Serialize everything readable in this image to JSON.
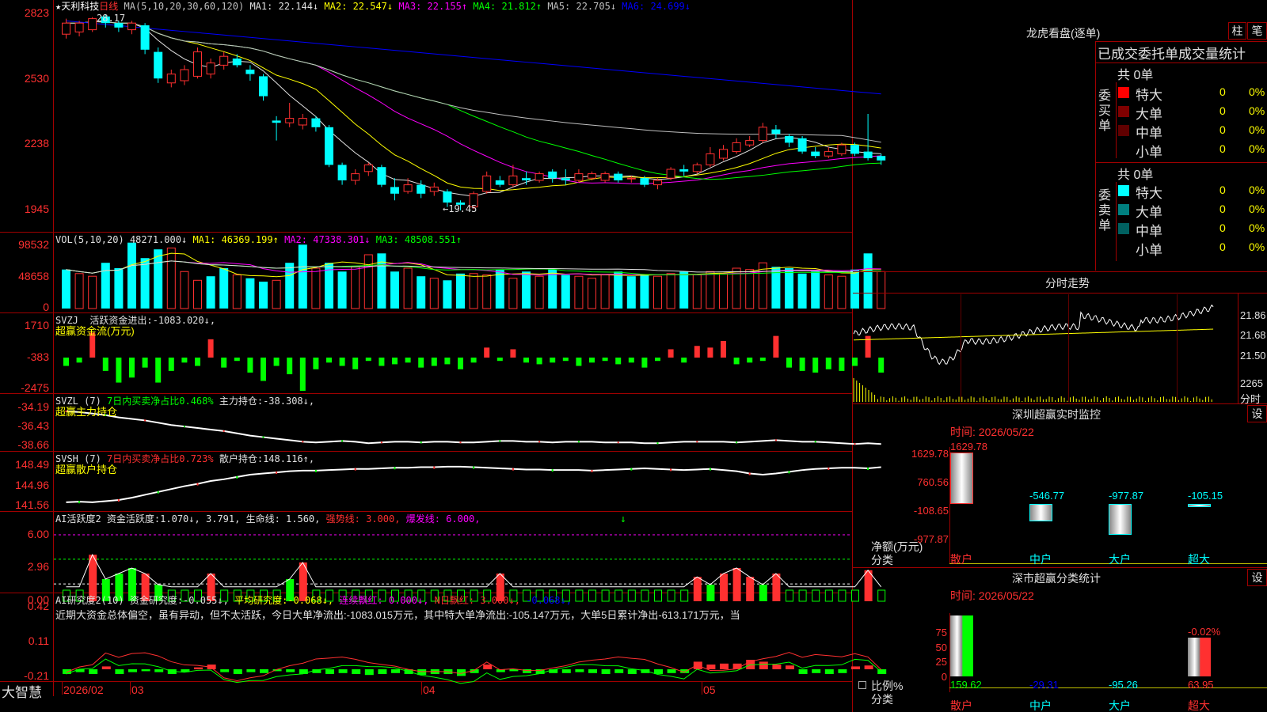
{
  "main": {
    "title_star": "★",
    "stock_name": "天利科技",
    "period": "日线",
    "ma_label": "MA(5,10,20,30,60,120)",
    "ma": [
      {
        "label": "MA1:",
        "value": "22.144",
        "arrow": "↓",
        "color": "#e0e0e0"
      },
      {
        "label": "MA2:",
        "value": "22.547",
        "arrow": "↓",
        "color": "#ffff00"
      },
      {
        "label": "MA3:",
        "value": "22.155",
        "arrow": "↑",
        "color": "#ff00ff"
      },
      {
        "label": "MA4:",
        "value": "21.812",
        "arrow": "↑",
        "color": "#00ff00"
      },
      {
        "label": "MA5:",
        "value": "22.705",
        "arrow": "↓",
        "color": "#c0c0c0"
      },
      {
        "label": "MA6:",
        "value": "24.699",
        "arrow": "↓",
        "color": "#0000ff"
      }
    ],
    "high_label": "28.17",
    "low_label": "←19.45",
    "y_labels": [
      "2823",
      "2530",
      "2238",
      "1945"
    ]
  },
  "vol": {
    "label": "VOL(5,10,20)",
    "value": "48271.000",
    "arrow": "↓",
    "ma": [
      {
        "label": "MA1:",
        "value": "46369.199",
        "arrow": "↑",
        "color": "#ffff00"
      },
      {
        "label": "MA2:",
        "value": "47338.301",
        "arrow": "↓",
        "color": "#ff00ff"
      },
      {
        "label": "MA3:",
        "value": "48508.551",
        "arrow": "↑",
        "color": "#00ff00"
      }
    ],
    "y_labels": [
      "98532",
      "48658",
      "0"
    ]
  },
  "svzj": {
    "label": "SVZJ",
    "title": "活跃资金进出:",
    "value": "-1083.020",
    "arrow": "↓,",
    "subtitle": "超赢资金流(万元)",
    "y_labels": [
      "1710",
      "-383",
      "-2475"
    ]
  },
  "svzl": {
    "label": "SVZL (7)",
    "desc": "7日内买卖净占比0.468%",
    "title": "主力持仓:",
    "value": "-38.308",
    "arrow": "↓,",
    "subtitle": "超赢主力持仓",
    "y_labels": [
      "-34.19",
      "-36.43",
      "-38.66"
    ]
  },
  "svsh": {
    "label": "SVSH (7)",
    "desc": "7日内买卖净占比0.723%",
    "title": "散户持仓:",
    "value": "148.116",
    "arrow": "↑,",
    "subtitle": "超赢散户持仓",
    "y_labels": [
      "148.49",
      "144.96",
      "141.56"
    ]
  },
  "ai_active": {
    "label": "AI活跃度2",
    "t1": "资金活跃度:",
    "v1": "1.070",
    "a1": "↓,",
    "v2": "3.791",
    "a2": ",",
    "t3": "生命线:",
    "v3": "1.560",
    "a3": ",",
    "t4": "强势线:",
    "v4": "3.000",
    "a4": ",",
    "t5": "爆发线:",
    "v5": "6.000",
    "a5": ",",
    "y_labels": [
      "6.00",
      "2.96",
      "0.00"
    ]
  },
  "ai_research": {
    "label": "AI研究度2(10)",
    "t1": "资金研究度:",
    "v1": "-0.055",
    "a1": "↓,",
    "t2": "平均研究度:",
    "v2": "-0.068",
    "a2": "↓,",
    "t3": "连续飘红:",
    "v3": "0.000",
    "a3": "↓,",
    "t4": "N日飘红:",
    "v4": "3.000",
    "a4": "↓,",
    "v5": "-0.068",
    "a5": "↓,",
    "comment": "近期大资金总体偏空，虽有异动，但不太活跃，今日大单净流出:-1083.015万元，其中特大单净流出:-105.147万元，大单5日累计净出-613.171万元，当",
    "y_labels": [
      "0.42",
      "0.11",
      "-0.21"
    ]
  },
  "footer": {
    "brand": "大智慧",
    "months": [
      "2026/02",
      "03",
      "04",
      "05"
    ]
  },
  "right": {
    "panel_title": "龙虎看盘(逐单)",
    "tab1": "柱",
    "tab2": "笔",
    "stats_title": "已成交委托单成交量统计",
    "buy": {
      "side_label": "委买单",
      "total": "共 0单",
      "rows": [
        {
          "name": "特大",
          "v": "0",
          "p": "0%",
          "color": "#ff0000"
        },
        {
          "name": "大单",
          "v": "0",
          "p": "0%",
          "color": "#800000"
        },
        {
          "name": "中单",
          "v": "0",
          "p": "0%",
          "color": "#600000"
        },
        {
          "name": "小单",
          "v": "0",
          "p": "0%",
          "color": "#000000"
        }
      ]
    },
    "sell": {
      "side_label": "委卖单",
      "total": "共 0单",
      "rows": [
        {
          "name": "特大",
          "v": "0",
          "p": "0%",
          "color": "#00ffff"
        },
        {
          "name": "大单",
          "v": "0",
          "p": "0%",
          "color": "#008080"
        },
        {
          "name": "中单",
          "v": "0",
          "p": "0%",
          "color": "#006060"
        },
        {
          "name": "小单",
          "v": "0",
          "p": "0%",
          "color": "#000000"
        }
      ]
    },
    "intraday": {
      "title": "分时走势",
      "y_labels": [
        "21.86",
        "21.68",
        "21.50"
      ],
      "vol_label": "2265",
      "vol_unit": "分时"
    },
    "monitor": {
      "title": "深圳超赢实时监控",
      "set": "设",
      "time": "时间: 2026/05/22",
      "y_labels": [
        "1629.78",
        "760.56",
        "-108.65",
        "-977.87"
      ],
      "unit1": "净额(万元)",
      "unit2": "分类",
      "bars": [
        {
          "cat": "散户",
          "value": "1629.78",
          "v": 1629.78
        },
        {
          "cat": "中户",
          "value": "-546.77",
          "v": -546.77
        },
        {
          "cat": "大户",
          "value": "-977.87",
          "v": -977.87
        },
        {
          "cat": "超大",
          "value": "-105.15",
          "v": -105.15
        }
      ]
    },
    "category": {
      "title": "深市超赢分类统计",
      "set": "设",
      "time": "时间: 2026/05/22",
      "y_labels": [
        "75",
        "50",
        "25",
        "0"
      ],
      "unit1": "比例%",
      "unit2": "分类",
      "top_label": "-0.02%",
      "cats": [
        {
          "cat": "散户",
          "value": "159.62",
          "color": "#00ff00",
          "h": 100
        },
        {
          "cat": "中户",
          "value": "-29.31",
          "color": "#0000ff",
          "h": 0
        },
        {
          "cat": "大户",
          "value": "-95.26",
          "color": "#00ffff",
          "h": 0
        },
        {
          "cat": "超大",
          "value": "63.95",
          "color": "#ff3030",
          "h": 64
        }
      ]
    }
  },
  "chart_data": {
    "type": "candlestick",
    "title": "天利科技 日线",
    "candles": [
      {
        "o": 27.4,
        "c": 27.9,
        "h": 28.1,
        "l": 27.2
      },
      {
        "o": 27.5,
        "c": 27.9,
        "h": 28.0,
        "l": 27.3
      },
      {
        "o": 27.6,
        "c": 28.1,
        "h": 28.17,
        "l": 27.5
      },
      {
        "o": 28.2,
        "c": 27.9,
        "h": 28.3,
        "l": 27.7
      },
      {
        "o": 27.9,
        "c": 27.7,
        "h": 28.0,
        "l": 27.5
      },
      {
        "o": 27.6,
        "c": 27.9,
        "h": 28.0,
        "l": 27.4
      },
      {
        "o": 27.8,
        "c": 26.7,
        "h": 27.9,
        "l": 26.5
      },
      {
        "o": 26.6,
        "c": 25.4,
        "h": 26.8,
        "l": 25.2
      },
      {
        "o": 25.2,
        "c": 25.6,
        "h": 25.8,
        "l": 25.0
      },
      {
        "o": 25.3,
        "c": 25.8,
        "h": 26.0,
        "l": 25.1
      },
      {
        "o": 25.5,
        "c": 26.6,
        "h": 26.8,
        "l": 25.4
      },
      {
        "o": 25.6,
        "c": 26.1,
        "h": 26.3,
        "l": 25.4
      },
      {
        "o": 26.0,
        "c": 26.4,
        "h": 26.6,
        "l": 25.8
      },
      {
        "o": 26.3,
        "c": 26.0,
        "h": 26.5,
        "l": 25.9
      },
      {
        "o": 25.8,
        "c": 25.6,
        "h": 26.0,
        "l": 25.3
      },
      {
        "o": 25.5,
        "c": 24.6,
        "h": 25.6,
        "l": 24.4
      },
      {
        "o": 23.5,
        "c": 23.4,
        "h": 23.7,
        "l": 22.6
      },
      {
        "o": 23.4,
        "c": 23.6,
        "h": 24.3,
        "l": 23.2
      },
      {
        "o": 23.3,
        "c": 23.6,
        "h": 23.8,
        "l": 23.1
      },
      {
        "o": 23.6,
        "c": 23.2,
        "h": 23.7,
        "l": 23.0
      },
      {
        "o": 23.2,
        "c": 21.5,
        "h": 23.3,
        "l": 21.4
      },
      {
        "o": 21.5,
        "c": 20.8,
        "h": 21.6,
        "l": 20.6
      },
      {
        "o": 20.8,
        "c": 21.1,
        "h": 21.3,
        "l": 20.6
      },
      {
        "o": 21.2,
        "c": 21.5,
        "h": 21.6,
        "l": 21.0
      },
      {
        "o": 21.4,
        "c": 20.6,
        "h": 21.5,
        "l": 20.5
      },
      {
        "o": 20.5,
        "c": 20.2,
        "h": 20.9,
        "l": 19.9
      },
      {
        "o": 20.3,
        "c": 20.6,
        "h": 20.9,
        "l": 20.2
      },
      {
        "o": 20.6,
        "c": 20.2,
        "h": 20.8,
        "l": 20.0
      },
      {
        "o": 20.3,
        "c": 20.5,
        "h": 20.7,
        "l": 20.1
      },
      {
        "o": 20.3,
        "c": 19.8,
        "h": 20.4,
        "l": 19.6
      },
      {
        "o": 19.8,
        "c": 19.7,
        "h": 19.9,
        "l": 19.45
      },
      {
        "o": 19.6,
        "c": 20.2,
        "h": 20.3,
        "l": 19.5
      },
      {
        "o": 20.3,
        "c": 21.0,
        "h": 21.2,
        "l": 20.2
      },
      {
        "o": 20.8,
        "c": 20.6,
        "h": 21.0,
        "l": 20.5
      },
      {
        "o": 20.6,
        "c": 21.0,
        "h": 21.5,
        "l": 20.5
      },
      {
        "o": 20.9,
        "c": 20.8,
        "h": 21.2,
        "l": 20.6
      },
      {
        "o": 20.8,
        "c": 21.1,
        "h": 21.2,
        "l": 20.7
      },
      {
        "o": 21.2,
        "c": 20.9,
        "h": 21.3,
        "l": 20.7
      },
      {
        "o": 20.9,
        "c": 20.8,
        "h": 21.3,
        "l": 20.6
      },
      {
        "o": 20.8,
        "c": 21.1,
        "h": 21.3,
        "l": 20.7
      },
      {
        "o": 20.9,
        "c": 21.1,
        "h": 21.2,
        "l": 20.8
      },
      {
        "o": 20.8,
        "c": 21.1,
        "h": 21.2,
        "l": 20.7
      },
      {
        "o": 21.1,
        "c": 20.8,
        "h": 21.2,
        "l": 20.7
      },
      {
        "o": 20.9,
        "c": 20.9,
        "h": 21.0,
        "l": 20.7
      },
      {
        "o": 20.9,
        "c": 20.6,
        "h": 21.0,
        "l": 20.5
      },
      {
        "o": 20.6,
        "c": 20.8,
        "h": 20.9,
        "l": 20.4
      },
      {
        "o": 20.9,
        "c": 21.3,
        "h": 21.4,
        "l": 20.8
      },
      {
        "o": 21.3,
        "c": 21.2,
        "h": 21.5,
        "l": 21.0
      },
      {
        "o": 21.2,
        "c": 21.5,
        "h": 21.6,
        "l": 21.1
      },
      {
        "o": 21.5,
        "c": 22.0,
        "h": 22.3,
        "l": 21.4
      },
      {
        "o": 21.8,
        "c": 22.2,
        "h": 22.4,
        "l": 21.7
      },
      {
        "o": 22.1,
        "c": 22.5,
        "h": 22.7,
        "l": 22.0
      },
      {
        "o": 22.4,
        "c": 22.6,
        "h": 22.8,
        "l": 22.3
      },
      {
        "o": 22.6,
        "c": 23.2,
        "h": 23.4,
        "l": 22.5
      },
      {
        "o": 23.1,
        "c": 22.9,
        "h": 23.3,
        "l": 22.7
      },
      {
        "o": 22.8,
        "c": 22.5,
        "h": 22.9,
        "l": 22.3
      },
      {
        "o": 22.7,
        "c": 22.1,
        "h": 22.8,
        "l": 22.0
      },
      {
        "o": 22.1,
        "c": 21.9,
        "h": 22.3,
        "l": 21.8
      },
      {
        "o": 21.9,
        "c": 22.1,
        "h": 22.3,
        "l": 21.8
      },
      {
        "o": 22.0,
        "c": 22.4,
        "h": 22.5,
        "l": 21.9
      },
      {
        "o": 22.4,
        "c": 22.0,
        "h": 22.5,
        "l": 21.9
      },
      {
        "o": 22.1,
        "c": 21.8,
        "h": 23.8,
        "l": 21.7
      },
      {
        "o": 21.9,
        "c": 21.7,
        "h": 22.0,
        "l": 21.5
      }
    ],
    "volume": [
      58,
      52,
      48,
      68,
      60,
      98,
      75,
      88,
      90,
      55,
      42,
      48,
      60,
      50,
      45,
      40,
      42,
      68,
      95,
      60,
      68,
      55,
      62,
      80,
      82,
      55,
      60,
      48,
      45,
      42,
      52,
      52,
      50,
      58,
      45,
      55,
      48,
      58,
      50,
      48,
      45,
      50,
      55,
      48,
      50,
      48,
      52,
      55,
      50,
      55,
      52,
      60,
      58,
      68,
      62,
      60,
      52,
      55,
      50,
      48,
      58,
      82,
      55
    ],
    "vol_up": [
      0,
      1,
      1,
      0,
      0,
      0,
      0,
      0,
      1,
      1,
      1,
      0,
      0,
      1,
      0,
      0,
      1,
      0,
      0,
      1,
      0,
      0,
      1,
      1,
      0,
      0,
      1,
      0,
      1,
      0,
      0,
      1,
      1,
      0,
      1,
      0,
      1,
      0,
      0,
      1,
      1,
      1,
      0,
      0,
      0,
      1,
      1,
      0,
      1,
      1,
      1,
      1,
      1,
      1,
      0,
      0,
      0,
      0,
      1,
      1,
      0,
      0,
      1
    ],
    "svzj": [
      -500,
      -300,
      1500,
      -800,
      -1500,
      -1200,
      -600,
      -1500,
      -800,
      -300,
      -500,
      1100,
      -600,
      -200,
      -900,
      -1400,
      -500,
      -1000,
      -2000,
      -700,
      -300,
      -500,
      -700,
      -200,
      -500,
      -400,
      -300,
      -600,
      -500,
      -400,
      -700,
      -300,
      600,
      -200,
      500,
      -300,
      -400,
      -300,
      -200,
      -500,
      -300,
      -200,
      -400,
      -300,
      -600,
      -200,
      500,
      -300,
      700,
      600,
      1000,
      -400,
      -300,
      -200,
      1300,
      -600,
      -800,
      -900,
      -700,
      -800,
      -500,
      1300,
      -900
    ],
    "svzl_line": [
      -34.0,
      -34.1,
      -34.3,
      -34.5,
      -34.8,
      -35.0,
      -35.2,
      -35.5,
      -35.8,
      -36.0,
      -36.2,
      -36.4,
      -36.6,
      -36.9,
      -37.2,
      -37.4,
      -37.6,
      -37.8,
      -38.0,
      -38.1,
      -38.0,
      -37.9,
      -38.0,
      -38.2,
      -38.1,
      -38.0,
      -38.0,
      -38.1,
      -38.0,
      -38.0,
      -38.1,
      -38.1,
      -38.0,
      -37.9,
      -37.9,
      -38.0,
      -38.0,
      -38.1,
      -38.0,
      -38.0,
      -38.0,
      -38.1,
      -38.1,
      -38.1,
      -38.2,
      -38.2,
      -38.1,
      -38.0,
      -38.0,
      -38.0,
      -38.0,
      -38.1,
      -38.0,
      -37.9,
      -37.8,
      -37.9,
      -38.0,
      -38.0,
      -38.1,
      -38.2,
      -38.3,
      -38.2,
      -38.3
    ],
    "svsh_line": [
      142.0,
      142.1,
      142.0,
      142.2,
      142.4,
      142.8,
      143.3,
      143.8,
      144.3,
      144.8,
      145.2,
      145.7,
      146.0,
      146.4,
      146.8,
      147.0,
      147.2,
      147.4,
      147.5,
      147.5,
      147.6,
      147.7,
      147.8,
      147.8,
      147.9,
      148.0,
      148.0,
      148.1,
      148.1,
      148.2,
      148.2,
      148.1,
      148.0,
      147.9,
      147.8,
      147.7,
      147.7,
      147.6,
      147.6,
      147.6,
      147.5,
      147.6,
      147.7,
      147.8,
      147.9,
      147.8,
      147.7,
      147.6,
      147.7,
      147.8,
      147.6,
      147.4,
      147.0,
      146.8,
      147.0,
      147.3,
      147.6,
      147.8,
      147.9,
      148.0,
      148.0,
      147.9,
      148.1
    ],
    "ai_active": [
      1,
      1,
      4.2,
      2,
      2.5,
      3,
      2.5,
      1.5,
      1,
      1,
      1,
      2.5,
      1,
      1,
      1,
      1,
      1,
      2,
      3.5,
      1,
      1,
      1,
      1,
      1,
      1,
      1,
      1,
      1,
      1,
      1,
      1,
      1,
      1,
      2.5,
      1,
      1,
      1,
      1,
      1,
      1,
      1,
      1,
      1,
      1,
      1,
      1,
      1,
      1,
      2.2,
      1.5,
      2.5,
      3,
      2.2,
      1.5,
      2.5,
      1,
      1,
      1,
      1,
      1,
      1,
      2.8,
      1
    ],
    "ai_research": [
      -0.05,
      -0.03,
      -0.05,
      0.03,
      -0.05,
      -0.03,
      -0.02,
      -0.03,
      -0.05,
      -0.03,
      0.02,
      0.05,
      -0.03,
      -0.05,
      -0.03,
      -0.04,
      -0.02,
      -0.03,
      -0.05,
      -0.04,
      -0.05,
      -0.04,
      -0.05,
      -0.06,
      -0.05,
      -0.04,
      -0.05,
      -0.06,
      -0.05,
      -0.05,
      -0.07,
      -0.04,
      0.05,
      -0.03,
      -0.02,
      -0.04,
      -0.05,
      -0.04,
      -0.04,
      -0.03,
      -0.04,
      -0.05,
      -0.04,
      -0.05,
      -0.04,
      -0.05,
      -0.04,
      -0.04,
      0.08,
      0.05,
      0.06,
      0.06,
      0.1,
      0.08,
      0.05,
      0.04,
      -0.05,
      -0.04,
      -0.05,
      -0.04,
      0.03,
      0.04,
      -0.05
    ]
  }
}
